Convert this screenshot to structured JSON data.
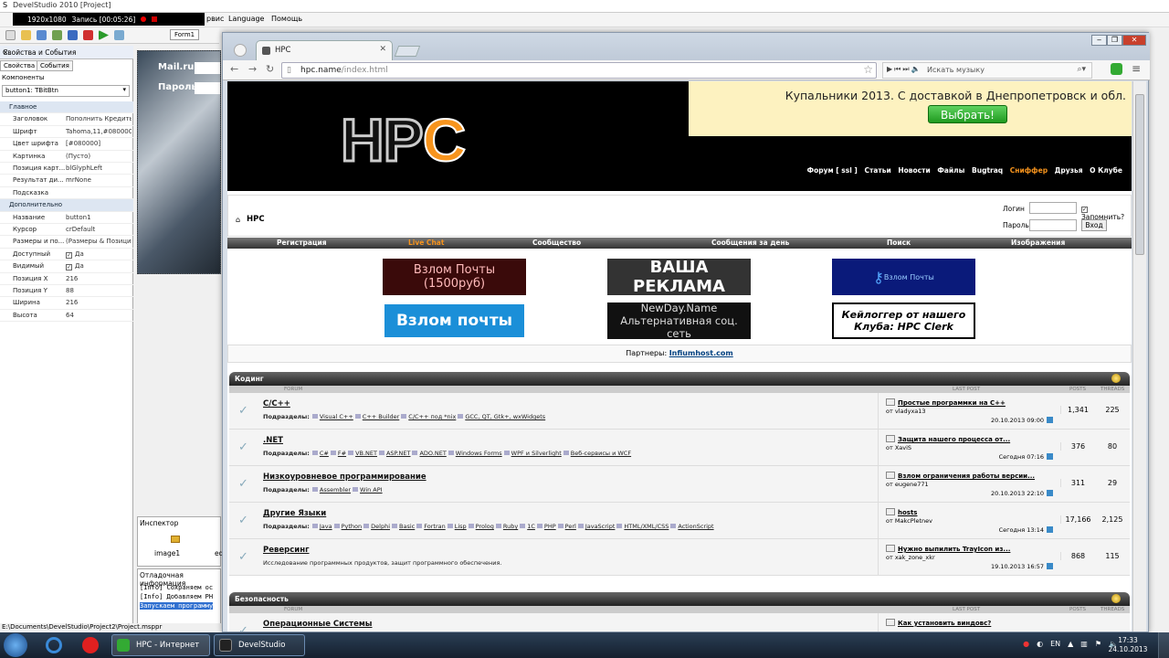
{
  "ide": {
    "title": "DevelStudio 2010 [Project]",
    "rec": {
      "resolution": "1920x1080",
      "recording": "Запись [00:05:26]"
    },
    "menu": [
      "рвис",
      "Language",
      "Помощь"
    ],
    "form_tab": "Form1",
    "props": {
      "panel_title": "Свойства и События",
      "tabs": [
        "Свойства",
        "События"
      ],
      "components_label": "Компоненты",
      "component": "button1: TBitBtn",
      "rows": [
        {
          "k": "Главное",
          "cat": true
        },
        {
          "k": "Заголовок",
          "v": "Пополнить Кредиты"
        },
        {
          "k": "Шрифт",
          "v": "Tahoma,11,#080000"
        },
        {
          "k": "Цвет шрифта",
          "v": "[#080000]"
        },
        {
          "k": "Картинка",
          "v": "(Пусто)"
        },
        {
          "k": "Позиция карт...",
          "v": "blGlyphLeft"
        },
        {
          "k": "Результат ди...",
          "v": "mrNone"
        },
        {
          "k": "Подсказка",
          "v": ""
        },
        {
          "k": "Дополнительно",
          "cat": true
        },
        {
          "k": "Название",
          "v": "button1"
        },
        {
          "k": "Курсор",
          "v": "crDefault"
        },
        {
          "k": "Размеры и по...",
          "v": "(Размеры & Позиция)"
        },
        {
          "k": "Доступный",
          "v": "Да",
          "check": true
        },
        {
          "k": "Видимый",
          "v": "Да",
          "check": true
        },
        {
          "k": "Позиция X",
          "v": "216"
        },
        {
          "k": "Позиция Y",
          "v": "88"
        },
        {
          "k": "Ширина",
          "v": "216"
        },
        {
          "k": "Высота",
          "v": "64"
        }
      ]
    },
    "designer": {
      "mail_label": "Mail.ru:",
      "pass_label": "Пароль:"
    },
    "inspector": {
      "title": "Инспектор",
      "item": "image1",
      "item2": "ed"
    },
    "debug": {
      "title": "Отладочная информация",
      "lines": [
        "[Info] Сохраняем ос",
        "[Info] Добавляем PH",
        "Запускаем программу"
      ]
    },
    "path": "E:\\Documents\\DevelStudio\\Project2\\Project.msppr"
  },
  "browser": {
    "tab_title": "HPC",
    "url_host": "hpc.name",
    "url_path": "/index.html",
    "music_placeholder": "Искать музыку",
    "site": {
      "logo_h": "HP",
      "logo_c": "C",
      "ad_text": "Купальники 2013. С доставкой в Днепропетровск и обл.",
      "ad_button": "Выбрать!",
      "top_nav": [
        "Форум [ ssl ]",
        "Статьи",
        "Новости",
        "Файлы",
        "Bugtraq",
        "Сниффер",
        "Друзья",
        "О Клубе"
      ],
      "home_label": "HPC",
      "login_label": "Логин",
      "remember_label": "Запомнить?",
      "password_label": "Пароль",
      "enter_button": "Вход",
      "main_nav": [
        "Регистрация",
        "Live Chat",
        "Сообщество",
        "Сообщения за день",
        "Поиск",
        "Изображения"
      ],
      "banners": [
        "Взлом Почты (1500руб)",
        "ВАША РЕКЛАМА",
        "Взлом Почты",
        "Взлом почты",
        "NewDay.Name Альтернативная соц. сеть",
        "Кейлоггер от нашего Клуба: HPC Clerk"
      ],
      "partners_label": "Партнеры:",
      "partners_link": "Infiumhost.com",
      "col_forum": "FORUM",
      "col_last": "LAST POST",
      "col_posts": "POSTS",
      "col_threads": "THREADS",
      "subforums_label": "Подразделы:",
      "categories": [
        {
          "name": "Кодинг"
        },
        {
          "name": "Безопасность"
        }
      ],
      "forums": [
        {
          "title": "C/C++",
          "subs": [
            "Visual C++",
            "C++ Builder",
            "C/C++ под *nix",
            "GCC, QT, Gtk+, wxWidgets"
          ],
          "last_title": "Простые программки на C++",
          "last_by": "от vladyxa13",
          "last_date": "20.10.2013 09:00",
          "posts": "1,341",
          "threads": "225"
        },
        {
          "title": ".NET",
          "subs": [
            "C#",
            "F#",
            "VB.NET",
            "ASP.NET",
            "ADO.NET",
            "Windows Forms",
            "WPF и Silverlight",
            "Веб-сервисы и WCF"
          ],
          "last_title": "Защита нашего процесса от...",
          "last_by": "от XaviS",
          "last_date": "Сегодня 07:16",
          "posts": "376",
          "threads": "80"
        },
        {
          "title": "Низкоуровневое программирование",
          "subs": [
            "Assembler",
            "Win API"
          ],
          "last_title": "Взлом ограничения работы версии...",
          "last_by": "от eugene771",
          "last_date": "20.10.2013 22:10",
          "posts": "311",
          "threads": "29"
        },
        {
          "title": "Другие Языки",
          "subs": [
            "Java",
            "Python",
            "Delphi",
            "Basic",
            "Fortran",
            "Lisp",
            "Prolog",
            "Ruby",
            "1C",
            "PHP",
            "Perl",
            "JavaScript",
            "HTML/XML/CSS",
            "ActionScript"
          ],
          "last_title": "hosts",
          "last_by": "от MakcPletnev",
          "last_date": "Сегодня 13:14",
          "posts": "17,166",
          "threads": "2,125"
        },
        {
          "title": "Реверсинг",
          "desc": "Исследование программных продуктов, защит программного обеспечения.",
          "last_title": "Нужно выпилить TrayIcon из...",
          "last_by": "от xak_zone_xkr",
          "last_date": "19.10.2013 16:57",
          "posts": "868",
          "threads": "115"
        },
        {
          "title": "Операционные Системы",
          "last_title": "Как установить виндовс?"
        }
      ]
    }
  },
  "taskbar": {
    "tasks": [
      "HPC - Интернет",
      "DevelStudio 2010 ..."
    ],
    "lang": "EN",
    "time": "17:33",
    "date": "24.10.2013"
  }
}
